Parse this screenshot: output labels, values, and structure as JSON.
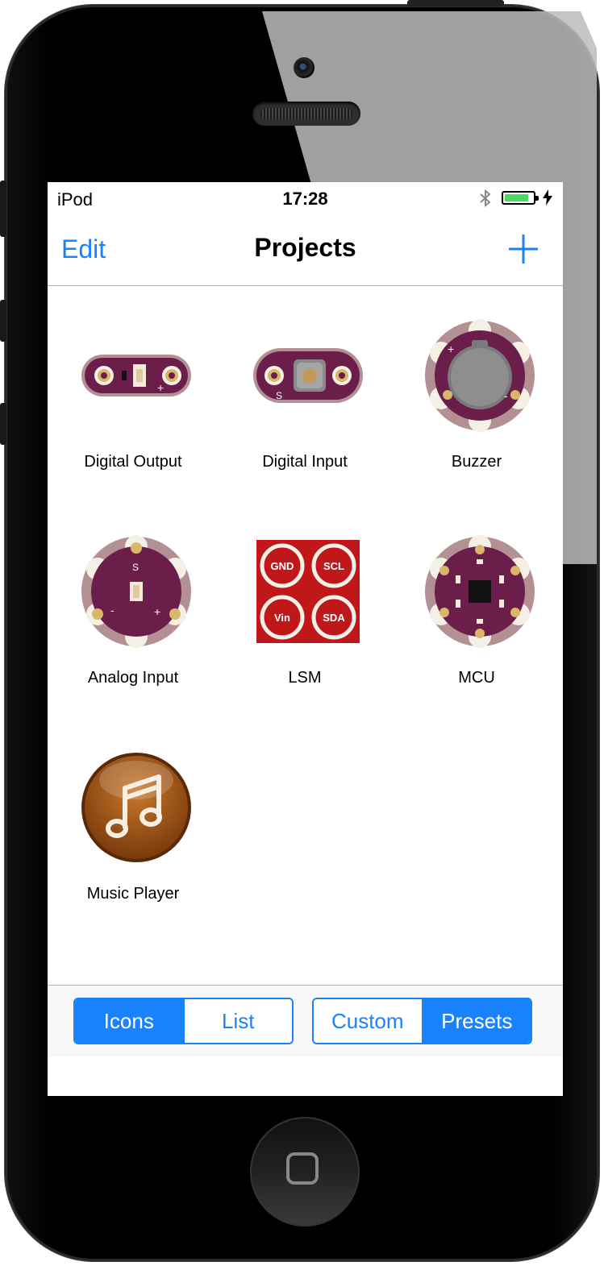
{
  "status_bar": {
    "carrier": "iPod",
    "time": "17:28",
    "battery_level": 0.85
  },
  "nav": {
    "edit_label": "Edit",
    "title": "Projects",
    "add_icon": "plus-icon"
  },
  "projects": [
    {
      "label": "Digital Output",
      "icon": "digital-output-board-icon"
    },
    {
      "label": "Digital Input",
      "icon": "digital-input-board-icon"
    },
    {
      "label": "Buzzer",
      "icon": "buzzer-board-icon"
    },
    {
      "label": "Analog Input",
      "icon": "analog-input-board-icon"
    },
    {
      "label": "LSM",
      "icon": "lsm-board-icon"
    },
    {
      "label": "MCU",
      "icon": "mcu-board-icon"
    },
    {
      "label": "Music Player",
      "icon": "music-note-icon"
    }
  ],
  "board_labels": {
    "lsm_gnd": "GND",
    "lsm_scl": "SCL",
    "lsm_vin": "Vin",
    "lsm_sda": "SDA",
    "plus": "+",
    "minus": "-",
    "s": "S"
  },
  "view_toggle": {
    "icons_label": "Icons",
    "list_label": "List",
    "selected": "Icons"
  },
  "source_toggle": {
    "custom_label": "Custom",
    "presets_label": "Presets",
    "selected": "Presets"
  },
  "colors": {
    "accent": "#1a82fb",
    "board_purple": "#6b1e4a",
    "board_pad": "#b39094",
    "lsm_red": "#c0171a",
    "music_brown": "#a0561a"
  }
}
